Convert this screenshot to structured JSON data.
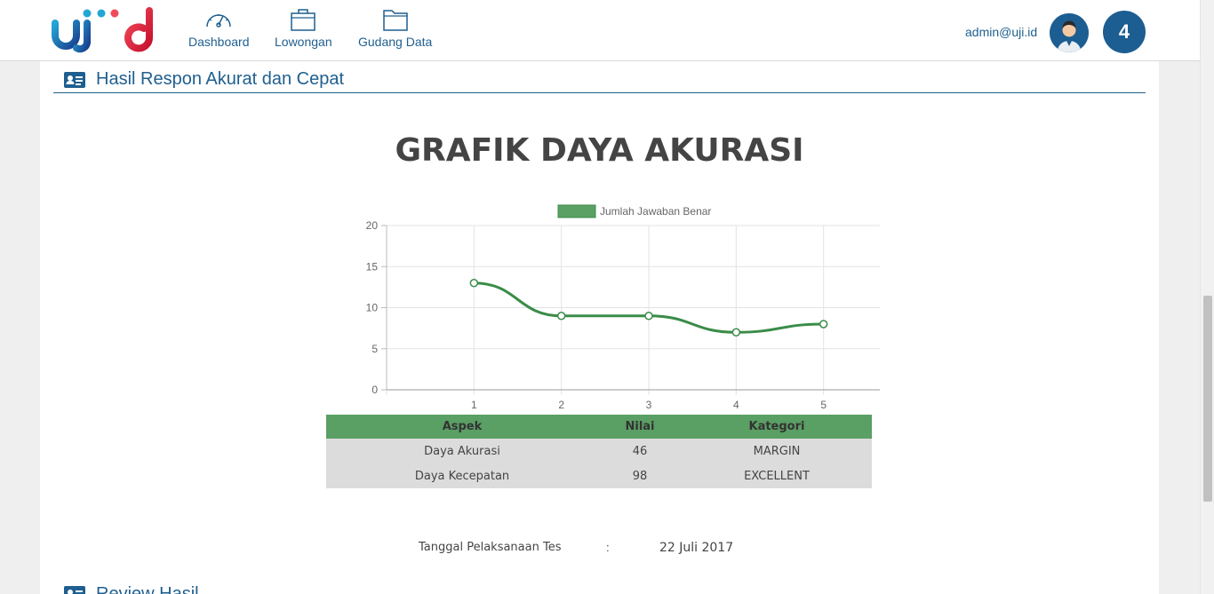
{
  "brand": {
    "logo_text": "ujiid"
  },
  "nav": {
    "items": [
      {
        "label": "Dashboard",
        "icon": "speedometer-icon"
      },
      {
        "label": "Lowongan",
        "icon": "briefcase-icon"
      },
      {
        "label": "Gudang Data",
        "icon": "folder-icon"
      }
    ]
  },
  "user": {
    "email": "admin@uji.id",
    "notification_count": "4"
  },
  "section": {
    "title": "Hasil Respon Akurat dan Cepat"
  },
  "chart_data": {
    "type": "line",
    "title": "GRAFIK DAYA AKURASI",
    "x": [
      1,
      2,
      3,
      4,
      5
    ],
    "series": [
      {
        "name": "Jumlah Jawaban Benar",
        "values": [
          13,
          9,
          9,
          7,
          8
        ],
        "color": "#3a8c48"
      }
    ],
    "xlabel": "",
    "ylabel": "",
    "ylim": [
      0,
      20
    ],
    "yticks": [
      0,
      5,
      10,
      15,
      20
    ],
    "legend": "top-center",
    "grid": true
  },
  "table": {
    "headers": [
      "Aspek",
      "Nilai",
      "Kategori"
    ],
    "rows": [
      [
        "Daya Akurasi",
        "46",
        "MARGIN"
      ],
      [
        "Daya Kecepatan",
        "98",
        "EXCELLENT"
      ]
    ]
  },
  "test_date": {
    "label": "Tanggal Pelaksanaan Tes",
    "separator": ":",
    "value": "22 Juli 2017"
  },
  "next_section": {
    "title": "Review Hasil"
  },
  "colors": {
    "primary": "#1f5f8f",
    "chart_green": "#3a8c48",
    "table_header": "#5a9f64"
  }
}
